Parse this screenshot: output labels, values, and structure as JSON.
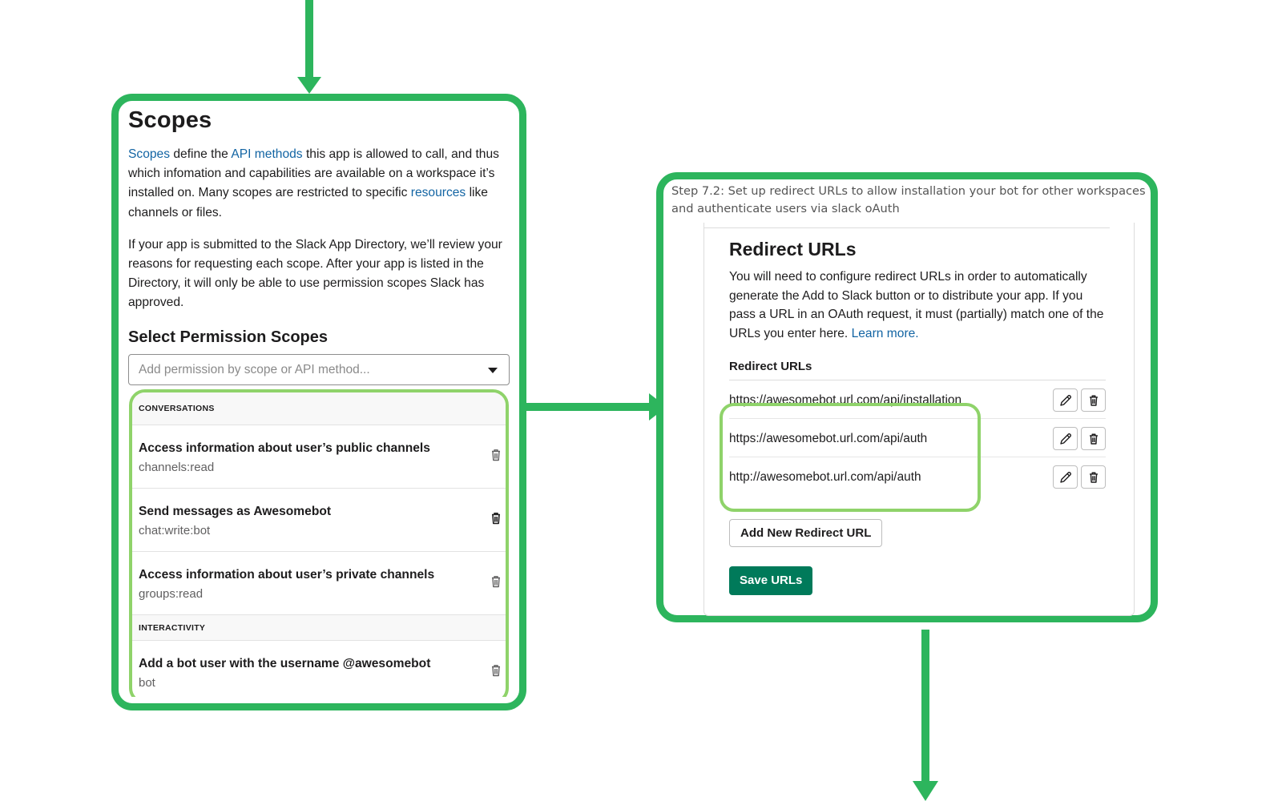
{
  "colors": {
    "annotation_green": "#2db55d",
    "highlight_green": "#8fd36a",
    "link_blue": "#1264a3",
    "save_button_green": "#007a5a"
  },
  "scopes": {
    "title": "Scopes",
    "intro": {
      "link1": "Scopes",
      "text1": " define the ",
      "link2": "API methods",
      "text2": " this app is allowed to call, and thus which infomation and capabilities are available on a workspace it’s installed on. Many scopes are restricted to specific ",
      "link3": "resources",
      "text3": " like channels or files."
    },
    "review_note": "If your app is submitted to the Slack App Directory, we’ll review your reasons for requesting each scope. After your app is listed in the Directory, it will only be able to use permission scopes Slack has approved.",
    "select_title": "Select Permission Scopes",
    "select_placeholder": "Add permission by scope or API method...",
    "sections": [
      {
        "heading": "CONVERSATIONS",
        "items": [
          {
            "description": "Access information about user’s public channels",
            "scope": "channels:read"
          },
          {
            "description": "Send messages as Awesomebot",
            "scope": "chat:write:bot"
          },
          {
            "description": "Access information about user’s private channels",
            "scope": "groups:read"
          }
        ]
      },
      {
        "heading": "INTERACTIVITY",
        "items": [
          {
            "description": "Add a bot user with the username @awesomebot",
            "scope": "bot"
          }
        ]
      }
    ]
  },
  "redirect": {
    "step_note": "Step 7.2: Set up redirect URLs to allow installation your bot for other workspaces and authenticate users via slack oAuth",
    "title": "Redirect URLs",
    "description": "You will need to configure redirect URLs in order to automatically generate the Add to Slack button or to distribute your app. If you pass a URL in an OAuth request, it must (partially) match one of the URLs you enter here. ",
    "learn_more": "Learn more.",
    "list_label": "Redirect URLs",
    "urls": [
      "https://awesomebot.url.com/api/installation",
      "https://awesomebot.url.com/api/auth",
      "http://awesomebot.url.com/api/auth"
    ],
    "add_button": "Add New Redirect URL",
    "save_button": "Save URLs"
  },
  "icons": {
    "trash": "trash-icon",
    "edit": "pencil-icon",
    "dropdown": "chevron-down-icon",
    "flow_arrow": "arrow-icon"
  }
}
